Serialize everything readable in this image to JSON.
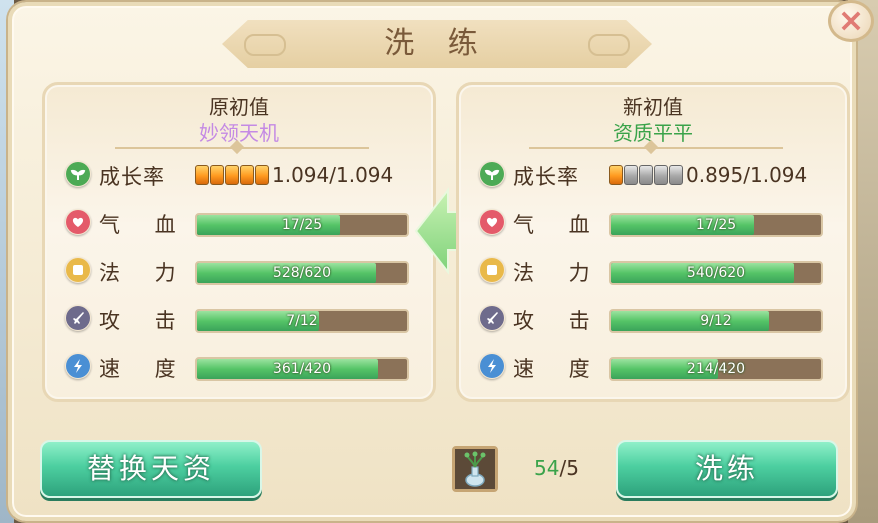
{
  "dialog": {
    "title": "洗 练",
    "close_label": "×"
  },
  "left_panel": {
    "title": "原初值",
    "subtitle": "妙领天机",
    "subtitle_color": "#c48ae4",
    "growth": {
      "label": "成长率",
      "pips_on": 5,
      "pips_total": 5,
      "value": "1.094/1.094"
    },
    "stats": [
      {
        "label": "气 血",
        "icon": "heart-icon",
        "value": "17/25",
        "fraction": 0.68
      },
      {
        "label": "法 力",
        "icon": "mana-square-icon",
        "value": "528/620",
        "fraction": 0.852
      },
      {
        "label": "攻 击",
        "icon": "sword-icon",
        "value": "7/12",
        "fraction": 0.583
      },
      {
        "label": "速 度",
        "icon": "lightning-icon",
        "value": "361/420",
        "fraction": 0.86
      }
    ]
  },
  "right_panel": {
    "title": "新初值",
    "subtitle": "资质平平",
    "subtitle_color": "#3aa34a",
    "growth": {
      "label": "成长率",
      "pips_on": 1,
      "pips_total": 5,
      "value": "0.895/1.094"
    },
    "stats": [
      {
        "label": "气 血",
        "icon": "heart-icon",
        "value": "17/25",
        "fraction": 0.68
      },
      {
        "label": "法 力",
        "icon": "mana-square-icon",
        "value": "540/620",
        "fraction": 0.871
      },
      {
        "label": "攻 击",
        "icon": "sword-icon",
        "value": "9/12",
        "fraction": 0.75
      },
      {
        "label": "速 度",
        "icon": "lightning-icon",
        "value": "214/420",
        "fraction": 0.51
      }
    ]
  },
  "actions": {
    "replace_label": "替换天资",
    "refine_label": "洗练"
  },
  "item": {
    "icon": "potion-vase-icon",
    "count_current": "54",
    "count_sep": "/",
    "count_required": "5",
    "count_current_color": "#3aa34a"
  },
  "colors": {
    "bar_fill": "#55c467",
    "button": "#4ccfa0",
    "growth_icon": "#4caa55",
    "hp_icon": "#e45a6a",
    "mp_icon": "#e9b94a",
    "atk_icon": "#6e6b8c",
    "spd_icon": "#4a8fd4"
  }
}
